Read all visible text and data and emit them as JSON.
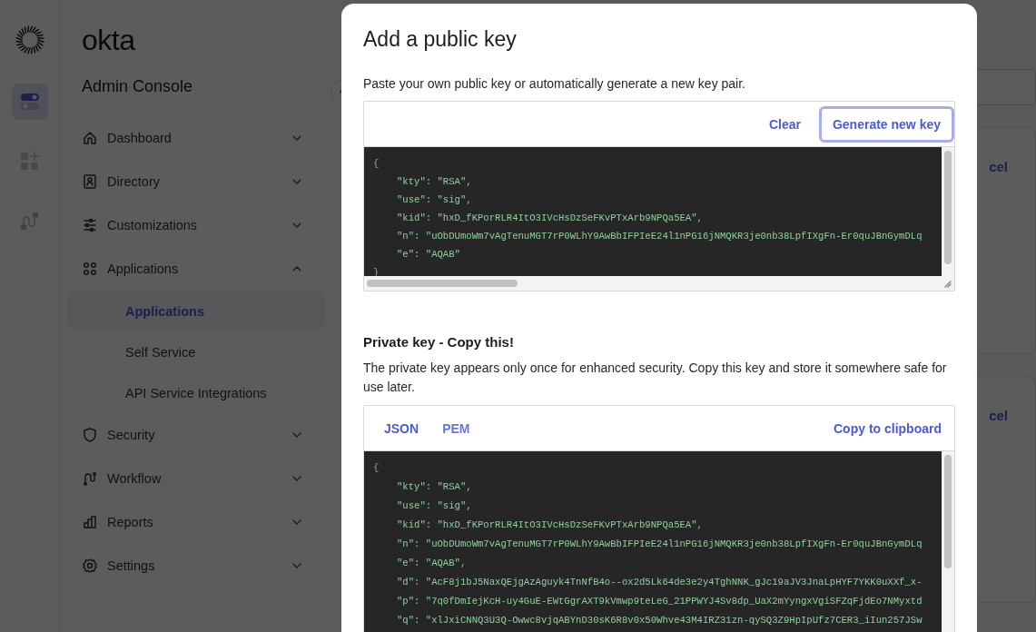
{
  "rail": {
    "items": [
      {
        "kind": "toggles",
        "selected": true
      },
      {
        "kind": "apps",
        "selected": false
      },
      {
        "kind": "workflow",
        "selected": false
      }
    ]
  },
  "sidebar": {
    "logo": "okta",
    "title": "Admin Console",
    "items": [
      {
        "label": "Dashboard",
        "kind": "home",
        "expanded": false
      },
      {
        "label": "Directory",
        "kind": "directory",
        "expanded": false
      },
      {
        "label": "Customizations",
        "kind": "sliders",
        "expanded": false
      },
      {
        "label": "Applications",
        "kind": "apps",
        "expanded": true,
        "children": [
          {
            "label": "Applications",
            "selected": true
          },
          {
            "label": "Self Service",
            "selected": false
          },
          {
            "label": "API Service Integrations",
            "selected": false
          }
        ]
      },
      {
        "label": "Security",
        "kind": "shield",
        "expanded": false
      },
      {
        "label": "Workflow",
        "kind": "workflow",
        "expanded": false
      },
      {
        "label": "Reports",
        "kind": "reports",
        "expanded": false
      },
      {
        "label": "Settings",
        "kind": "gear",
        "expanded": false
      }
    ]
  },
  "background_cards": [
    {
      "link": "cel"
    },
    {
      "link": "cel"
    }
  ],
  "dialog": {
    "title": "Add a public key",
    "intro": "Paste your own public key or automatically generate a new key pair.",
    "public_key": {
      "actions": [
        {
          "label": "Clear",
          "focused": false
        },
        {
          "label": "Generate new key",
          "focused": true
        }
      ],
      "lines": [
        "{",
        "\"kty\": \"RSA\",",
        "\"use\": \"sig\",",
        "\"kid\": \"hxD_fKPorRLR4ItO3IVcHsDzSeFKvPTxArb9NPQa5EA\",",
        "\"n\": \"uObDUmoWm7vAgTenuMGT7rP0WLhY9AwBbIFPIeE24l1nPG16jNMQKR3je0nb38LpfIXgFn-Er0quJBnGymDLq",
        "\"e\": \"AQAB\"",
        "}"
      ]
    },
    "private_key": {
      "title": "Private key - Copy this!",
      "description": "The private key appears only once for enhanced security. Copy this key and store it somewhere safe for use later.",
      "formats": [
        {
          "label": "JSON",
          "selected": true
        },
        {
          "label": "PEM",
          "selected": false
        }
      ],
      "copy": "Copy to clipboard",
      "lines": [
        "{",
        "\"kty\": \"RSA\",",
        "\"use\": \"sig\",",
        "\"kid\": \"hxD_fKPorRLR4ItO3IVcHsDzSeFKvPTxArb9NPQa5EA\",",
        "\"n\": \"uObDUmoWm7vAgTenuMGT7rP0WLhY9AwBbIFPIeE24l1nPG16jNMQKR3je0nb38LpfIXgFn-Er0quJBnGymDLq",
        "\"e\": \"AQAB\",",
        "\"d\": \"AcF8j1bJ5NaxQEjgAzAguyk4TnNfB4o--ox2d5Lk64de3e2y4TghNNK_gJc19aJV3JnaLpHYF7YKK0uXXf_x-",
        "\"p\": \"7q0fDmIejKcH-uy4GuE-EWtGgrAXT9kVmwp9teLeG_21PPWYJ4Sv8dp_UaX2mYyngxVgiSFZqFjdEo7NMyxtd",
        "\"q\": \"xlJxiCNNQ3U3Q-Owwc8vjqABYnD30sK6R8v0x50Whve43M4IRZ31zn-qySQ3Z9HpIpUfz7CER3_iIun257JSw"
      ]
    }
  }
}
